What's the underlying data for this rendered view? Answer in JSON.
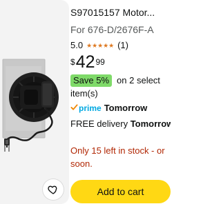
{
  "product": {
    "title": "S97015157 Motor...",
    "subtitle": "For 676-D/2676F-A",
    "rating": {
      "value": "5.0",
      "stars": 5,
      "count_text": "(1)"
    },
    "price": {
      "currency": "$",
      "whole": "42",
      "fraction": "99"
    },
    "savings": {
      "badge": "Save 5%",
      "text": "on 2 select",
      "items_text": "item(s)"
    },
    "prime": {
      "brand": "prime",
      "label": "Tomorrow"
    },
    "delivery": {
      "prefix": "FREE delivery ",
      "day": "Tomorrow"
    },
    "stock": {
      "line1": "Only 15 left in stock - or",
      "line2": "soon."
    },
    "actions": {
      "add_to_cart": "Add to cart"
    }
  },
  "icons": {
    "wishlist": "heart-icon",
    "prime_check": "check-icon",
    "product_image": "blower-motor-image"
  },
  "colors": {
    "rating_stars": "#de7921",
    "savings_badge": "#7fda69",
    "prime_blue": "#00a8e1",
    "stock_red": "#b12704",
    "add_to_cart": "#ffd814",
    "card_bg": "#f3f3f3"
  }
}
